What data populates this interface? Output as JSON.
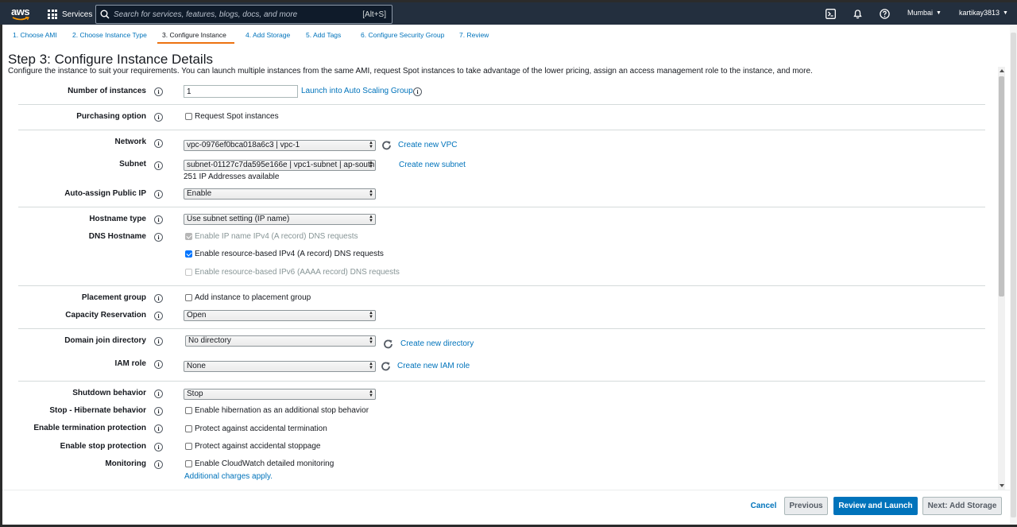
{
  "nav": {
    "logo": "aws",
    "services_label": "Services",
    "search_placeholder": "Search for services, features, blogs, docs, and more",
    "search_shortcut": "[Alt+S]",
    "region": "Mumbai",
    "account": "kartikay3813",
    "icons": [
      "cloudshell-icon",
      "bell-icon",
      "help-icon"
    ]
  },
  "wizard": {
    "tabs": [
      "1. Choose AMI",
      "2. Choose Instance Type",
      "3. Configure Instance",
      "4. Add Storage",
      "5. Add Tags",
      "6. Configure Security Group",
      "7. Review"
    ],
    "active_index": 2
  },
  "page": {
    "title": "Step 3: Configure Instance Details",
    "description": "Configure the instance to suit your requirements. You can launch multiple instances from the same AMI, request Spot instances to take advantage of the lower pricing, assign an access management role to the instance, and more."
  },
  "form": {
    "instances": {
      "label": "Number of instances",
      "value": "1",
      "link": "Launch into Auto Scaling Group"
    },
    "purchasing": {
      "label": "Purchasing option",
      "checkbox": "Request Spot instances",
      "checked": false
    },
    "network": {
      "label": "Network",
      "value": "vpc-0976ef0bca018a6c3 | vpc-1",
      "link": "Create new VPC"
    },
    "subnet": {
      "label": "Subnet",
      "value": "subnet-01127c7da595e166e | vpc1-subnet | ap-south",
      "link": "Create new subnet",
      "note": "251 IP Addresses available"
    },
    "public_ip": {
      "label": "Auto-assign Public IP",
      "value": "Enable"
    },
    "hostname_type": {
      "label": "Hostname type",
      "value": "Use subnet setting (IP name)"
    },
    "dns_hostname": {
      "label": "DNS Hostname",
      "options": [
        {
          "text": "Enable IP name IPv4 (A record) DNS requests",
          "checked": true,
          "disabled": true
        },
        {
          "text": "Enable resource-based IPv4 (A record) DNS requests",
          "checked": true,
          "disabled": false
        },
        {
          "text": "Enable resource-based IPv6 (AAAA record) DNS requests",
          "checked": false,
          "disabled": true
        }
      ]
    },
    "placement": {
      "label": "Placement group",
      "checkbox": "Add instance to placement group",
      "checked": false
    },
    "capacity": {
      "label": "Capacity Reservation",
      "value": "Open"
    },
    "domain": {
      "label": "Domain join directory",
      "value": "No directory",
      "link": "Create new directory"
    },
    "iam": {
      "label": "IAM role",
      "value": "None",
      "link": "Create new IAM role"
    },
    "shutdown": {
      "label": "Shutdown behavior",
      "value": "Stop"
    },
    "hibernate": {
      "label": "Stop - Hibernate behavior",
      "checkbox": "Enable hibernation as an additional stop behavior",
      "checked": false
    },
    "termination": {
      "label": "Enable termination protection",
      "checkbox": "Protect against accidental termination",
      "checked": false
    },
    "stop_protection": {
      "label": "Enable stop protection",
      "checkbox": "Protect against accidental stoppage",
      "checked": false
    },
    "monitoring": {
      "label": "Monitoring",
      "checkbox": "Enable CloudWatch detailed monitoring",
      "checked": false,
      "link": "Additional charges apply."
    }
  },
  "footer": {
    "cancel": "Cancel",
    "previous": "Previous",
    "review": "Review and Launch",
    "next": "Next: Add Storage"
  },
  "colors": {
    "nav_bg": "#232f3e",
    "link": "#0073bb",
    "active_tab": "#ec7211",
    "primary_button": "#0073bb"
  }
}
